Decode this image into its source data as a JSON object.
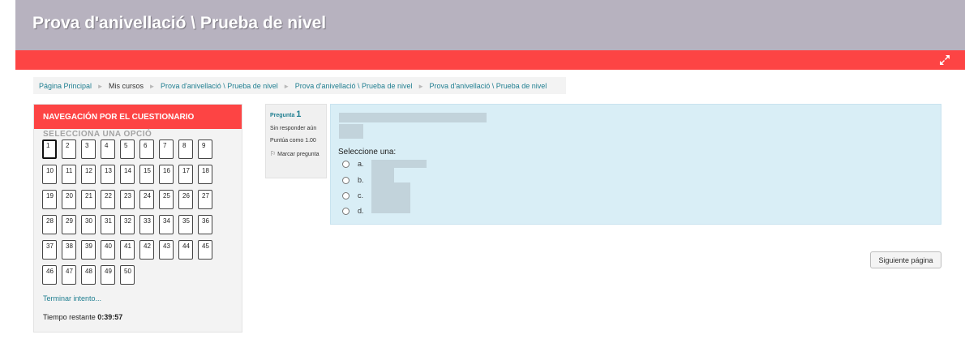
{
  "header": {
    "title": "Prova d'anivellació \\ Prueba de nivel"
  },
  "redbar": {
    "expand_icon": "expand-arrows-icon"
  },
  "breadcrumb": {
    "items": [
      "Página Principal",
      "Mis cursos",
      "Prova d'anivellació \\ Prueba de nivel",
      "Prova d'anivellació \\ Prueba de nivel",
      "Prova d'anivellació \\ Prueba de nivel"
    ]
  },
  "quiz_nav": {
    "title": "NAVEGACIÓN POR EL CUESTIONARIO",
    "section_label": "SELECCIONA UNA OPCIÓ",
    "questions": [
      "1",
      "2",
      "3",
      "4",
      "5",
      "6",
      "7",
      "8",
      "9",
      "10",
      "11",
      "12",
      "13",
      "14",
      "15",
      "16",
      "17",
      "18",
      "19",
      "20",
      "21",
      "22",
      "23",
      "24",
      "25",
      "26",
      "27",
      "28",
      "29",
      "30",
      "31",
      "32",
      "33",
      "34",
      "35",
      "36",
      "37",
      "38",
      "39",
      "40",
      "41",
      "42",
      "43",
      "44",
      "45",
      "46",
      "47",
      "48",
      "49",
      "50"
    ],
    "current": "1",
    "finish_link": "Terminar intento...",
    "timer_label": "Tiempo restante",
    "timer_value": "0:39:57"
  },
  "question": {
    "label": "Pregunta",
    "number": "1",
    "status": "Sin responder aún",
    "score": "Puntúa como 1.00",
    "flag_label": "Marcar pregunta",
    "select_one": "Seleccione una:",
    "answers": [
      "a.",
      "b.",
      "c.",
      "d."
    ]
  },
  "footer": {
    "next_button": "Siguiente página"
  },
  "colors": {
    "accent_red": "#fd4444",
    "header_gray": "#b7b2bf",
    "link_teal": "#217f91",
    "question_bg": "#d9eef6"
  }
}
